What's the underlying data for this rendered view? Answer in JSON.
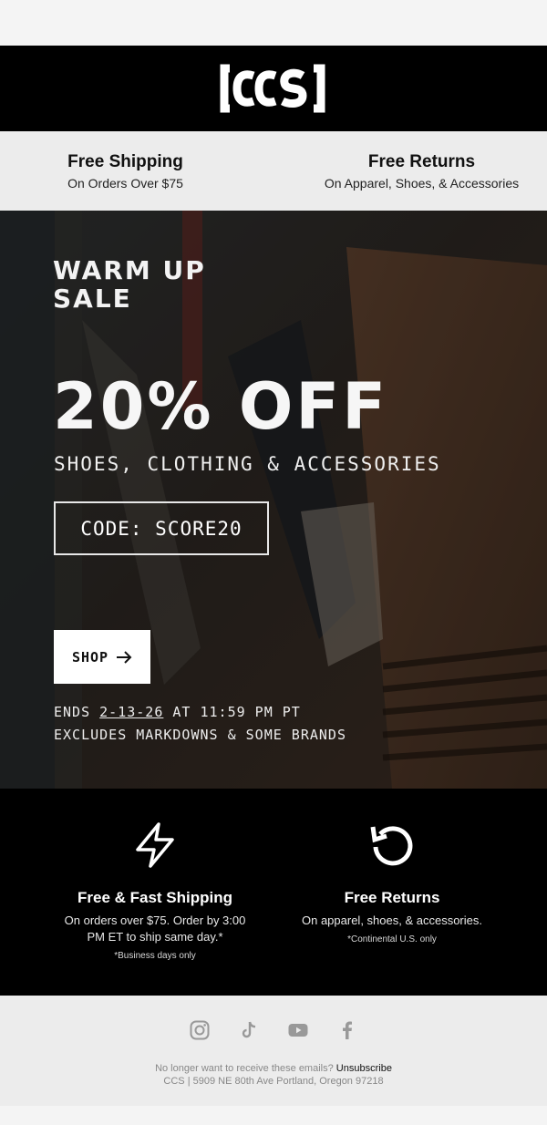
{
  "brand": {
    "logo_text": "[CCS]",
    "accent": "#000000"
  },
  "benefits": [
    {
      "title": "Free Shipping",
      "subtitle": "On Orders Over $75"
    },
    {
      "title": "Free Returns",
      "subtitle": "On Apparel, Shoes, & Accessories"
    }
  ],
  "hero": {
    "headline_line1": "WARM UP",
    "headline_line2": "SALE",
    "discount": "20% OFF",
    "categories": "SHOES, CLOTHING & ACCESSORIES",
    "code": "CODE: SCORE20",
    "shop_label": "SHOP",
    "ends_prefix": "ENDS",
    "ends_date": "2-13-26",
    "ends_suffix": "AT 11:59 PM PT",
    "excludes": "EXCLUDES MARKDOWNS & SOME BRANDS"
  },
  "perks": [
    {
      "icon": "lightning-icon",
      "title": "Free & Fast Shipping",
      "description": "On orders over $75. Order by 3:00 PM ET to ship same day.*",
      "note": "*Business days only"
    },
    {
      "icon": "return-arrow-icon",
      "title": "Free Returns",
      "description": "On apparel, shoes, & accessories.",
      "note": "*Continental U.S. only"
    }
  ],
  "footer": {
    "socials": [
      "instagram-icon",
      "tiktok-icon",
      "youtube-icon",
      "facebook-icon"
    ],
    "unsubscribe_prompt": "No longer want to receive these emails?",
    "unsubscribe_link": "Unsubscribe",
    "address": "CCS | 5909 NE 80th Ave Portland, Oregon 97218"
  }
}
